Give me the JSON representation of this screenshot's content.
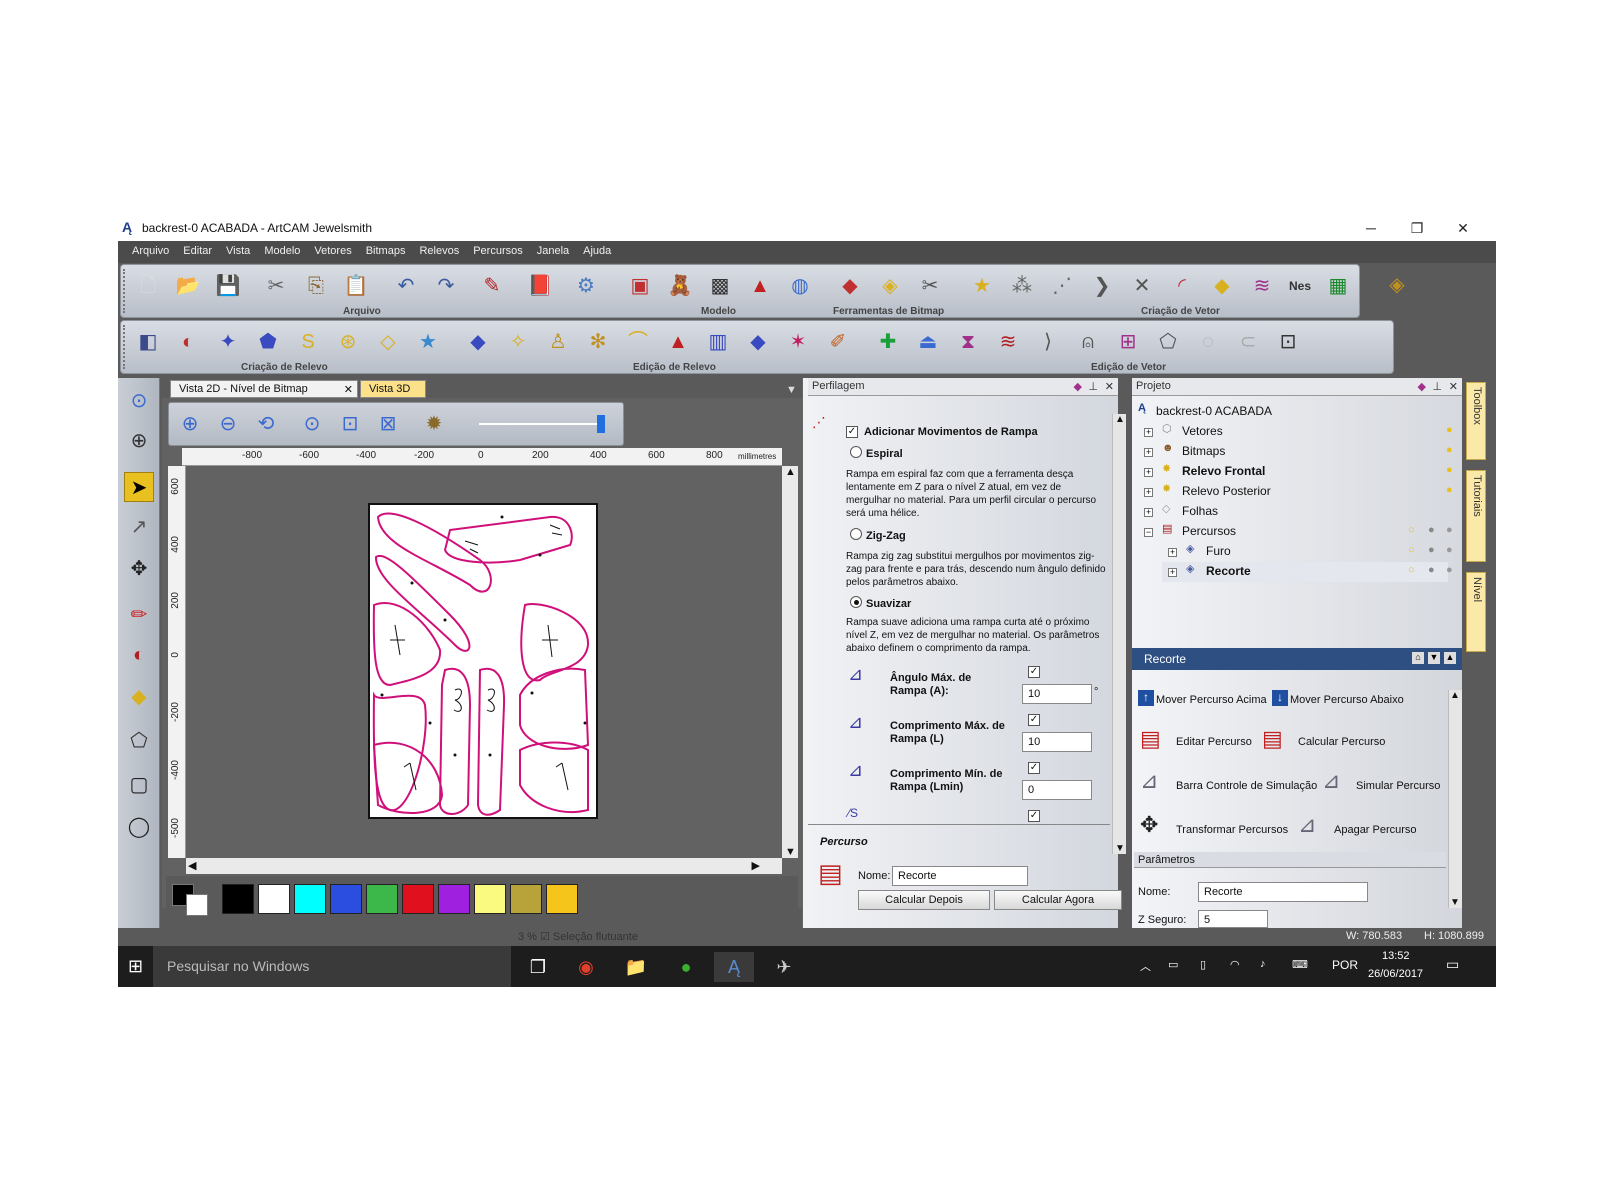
{
  "window": {
    "title": "backrest-0 ACABADA - ArtCAM Jewelsmith"
  },
  "menu": [
    "Arquivo",
    "Editar",
    "Vista",
    "Modelo",
    "Vetores",
    "Bitmaps",
    "Relevos",
    "Percursos",
    "Janela",
    "Ajuda"
  ],
  "toolbars": {
    "arquivo": "Arquivo",
    "modelo": "Modelo",
    "ferramentas_bitmap": "Ferramentas de Bitmap",
    "criacao_vetor": "Criação de Vetor",
    "criacao_relevo": "Criação de Relevo",
    "edicao_relevo": "Edição de Relevo",
    "edicao_vetor": "Edição de Vetor"
  },
  "view": {
    "tab_2d": "Vista 2D - Nível de Bitmap",
    "tab_3d": "Vista 3D",
    "ruler_unit": "millimetres",
    "ruler_top": [
      "-800",
      "-600",
      "-400",
      "-200",
      "0",
      "200",
      "400",
      "600",
      "800"
    ],
    "ruler_left": [
      "600",
      "400",
      "200",
      "0",
      "-200",
      "-400",
      "-500"
    ]
  },
  "palette": {
    "colors": [
      "#000000",
      "#ffffff",
      "#00ffff",
      "#2b4de0",
      "#3cb84a",
      "#e0101e",
      "#a020e0",
      "#fafa80",
      "#b8a23a",
      "#f5c51c"
    ]
  },
  "perfilagem": {
    "title": "Perfilagem",
    "ramp_check": "Adicionar Movimentos de Rampa",
    "espiral": "Espiral",
    "espiral_desc": "Rampa em espiral faz com que a ferramenta desça lentamente em Z para o nível Z atual, em vez de mergulhar no material. Para um perfil circular o percurso será uma hélice.",
    "zigzag": "Zig-Zag",
    "zigzag_desc": "Rampa zig zag substitui mergulhos por movimentos zig-zag para frente e para trás, descendo num ângulo definido pelos parâmetros abaixo.",
    "suavizar": "Suavizar",
    "suavizar_desc": "Rampa suave adiciona uma rampa curta até o próximo nível Z, em vez de mergulhar no material. Os parâmetros abaixo definem o comprimento da rampa.",
    "angulo_label": "Ângulo Máx. de Rampa  (A):",
    "angulo_value": "10",
    "angulo_unit": "°",
    "comp_max_label": "Comprimento Máx. de Rampa (L)",
    "comp_max_value": "10",
    "comp_min_label": "Comprimento Mín. de Rampa (Lmin)",
    "comp_min_value": "0",
    "percurso_section": "Percurso",
    "nome_label": "Nome:",
    "nome_value": "Recorte",
    "calc_depois": "Calcular Depois",
    "calc_agora": "Calcular Agora"
  },
  "projeto": {
    "title": "Projeto",
    "root": "backrest-0 ACABADA",
    "items": [
      "Vetores",
      "Bitmaps",
      "Relevo Frontal",
      "Relevo Posterior",
      "Folhas",
      "Percursos",
      "Furo",
      "Recorte"
    ]
  },
  "recorte": {
    "title": "Recorte",
    "mover_acima": "Mover Percurso Acima",
    "mover_abaixo": "Mover Percurso Abaixo",
    "editar": "Editar Percurso",
    "calcular": "Calcular Percurso",
    "barra_sim": "Barra Controle de Simulação",
    "simular": "Simular Percurso",
    "transformar": "Transformar Percursos",
    "apagar": "Apagar Percurso",
    "parametros": "Parâmetros",
    "nome_label": "Nome:",
    "nome_value": "Recorte",
    "zseguro_label": "Z Seguro:",
    "zseguro_value": "5"
  },
  "side_tabs": [
    "Toolbox",
    "Tutoriais",
    "Nível"
  ],
  "status": {
    "w": "W: 780.583",
    "h": "H: 1080.899",
    "left": "3 % ☑ Seleção flutuante"
  },
  "taskbar": {
    "search": "Pesquisar no Windows",
    "lang": "POR",
    "time": "13:52",
    "date": "26/06/2017"
  }
}
